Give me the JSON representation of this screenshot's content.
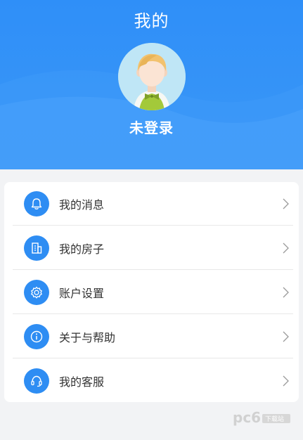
{
  "header": {
    "title": "我的",
    "user_name": "未登录",
    "colors": {
      "bg": "#2f8ff8",
      "wave": "#5aa8fb"
    }
  },
  "menu": {
    "items": [
      {
        "label": "我的消息",
        "icon": "bell-icon"
      },
      {
        "label": "我的房子",
        "icon": "building-icon"
      },
      {
        "label": "账户设置",
        "icon": "gear-icon"
      },
      {
        "label": "关于与帮助",
        "icon": "info-icon"
      },
      {
        "label": "我的客服",
        "icon": "headset-icon"
      }
    ],
    "colors": {
      "icon_bg": "#2e8df3",
      "text": "#333333",
      "chevron": "#9a9a9a"
    }
  },
  "watermark": {
    "text": "pc6",
    "sub": "下载站"
  }
}
